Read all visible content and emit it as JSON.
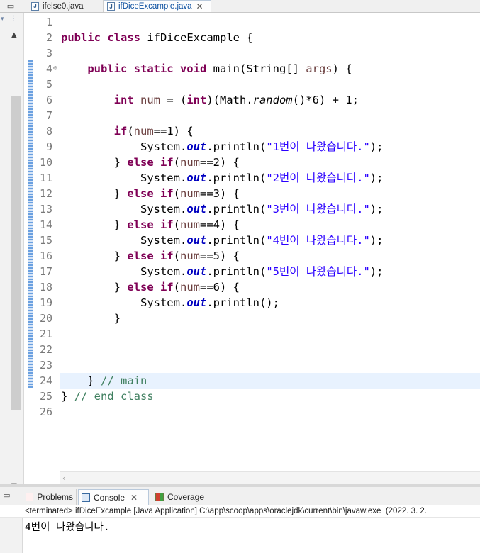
{
  "editor": {
    "tabs": [
      {
        "label": "ifelse0.java",
        "active": false
      },
      {
        "label": "ifDiceExcample.java",
        "active": true,
        "close": "✕"
      }
    ],
    "line_numbers": [
      "1",
      "2",
      "3",
      "4",
      "5",
      "6",
      "7",
      "8",
      "9",
      "10",
      "11",
      "12",
      "13",
      "14",
      "15",
      "16",
      "17",
      "18",
      "19",
      "20",
      "21",
      "22",
      "23",
      "24",
      "25",
      "26"
    ],
    "fold_marker": "⊖",
    "current_line": 24,
    "code": {
      "l2_public": "public",
      "l2_class": "class",
      "l2_name": " ifDiceExcample {",
      "l4_mods": "public static void",
      "l4_main": " main(String[] ",
      "l4_args": "args",
      "l4_end": ") {",
      "l6_int": "int",
      "l6_num": " num",
      "l6_eq": " = (",
      "l6_cast": "int",
      "l6_math": ")(Math.",
      "l6_random": "random",
      "l6_end": "()*6) + 1;",
      "if_kw": "if",
      "else_kw": "else",
      "close_brace": "} ",
      "num_var": "num",
      "sys": "System.",
      "out": "out",
      "println": ".println(",
      "cond_1": "==1) {",
      "cond_2": "==2) {",
      "cond_3": "==3) {",
      "cond_4": "==4) {",
      "cond_5": "==5) {",
      "cond_6": "==6) {",
      "str_1": "\"1번이 나왔습니다.\"",
      "str_2": "\"2번이 나왔습니다.\"",
      "str_3": "\"3번이 나왔습니다.\"",
      "str_4": "\"4번이 나왔습니다.\"",
      "str_5": "\"5번이 나왔습니다.\"",
      "str_end": ");",
      "println_empty": ".println();",
      "brace": "}",
      "l24_brace": "} ",
      "l24_comment": "// main",
      "l25_brace": "} ",
      "l25_comment": "// end class",
      "paren_open": "("
    }
  },
  "console": {
    "tabs": {
      "problems": "Problems",
      "console": "Console",
      "console_close": "✕",
      "coverage": "Coverage"
    },
    "status": "<terminated> ifDiceExcample [Java Application] C:\\app\\scoop\\apps\\oraclejdk\\current\\bin\\javaw.exe  (2022. 3. 2.",
    "output": "4번이 나왔습니다."
  }
}
